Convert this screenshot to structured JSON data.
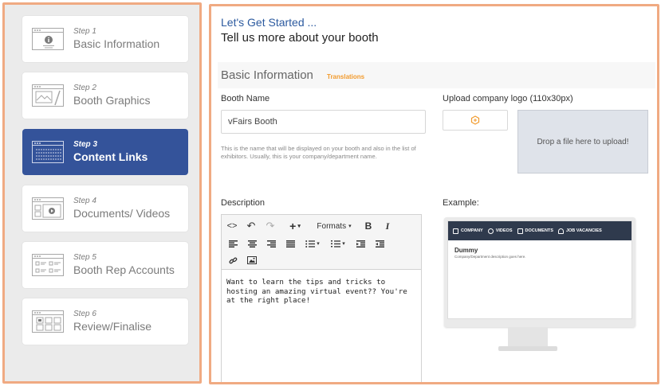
{
  "steps": [
    {
      "num": "Step 1",
      "label": "Basic Information",
      "icon": "info-window-icon"
    },
    {
      "num": "Step 2",
      "label": "Booth Graphics",
      "icon": "graphics-window-icon"
    },
    {
      "num": "Step 3",
      "label": "Content Links",
      "icon": "links-window-icon"
    },
    {
      "num": "Step 4",
      "label": "Documents/ Videos",
      "icon": "video-window-icon"
    },
    {
      "num": "Step 5",
      "label": "Booth Rep Accounts",
      "icon": "accounts-window-icon"
    },
    {
      "num": "Step 6",
      "label": "Review/Finalise",
      "icon": "review-window-icon"
    }
  ],
  "active_step": 2,
  "header": {
    "title": "Let's Get Started ...",
    "subtitle": "Tell us more about your booth"
  },
  "section": {
    "title": "Basic Information",
    "translations_link": "Translations"
  },
  "booth_name": {
    "label": "Booth Name",
    "value": "vFairs Booth",
    "help": "This is the name that will be displayed on your booth and also in the list of exhibitors. Usually, this is your company/department name."
  },
  "upload": {
    "label": "Upload company logo (110x30px)",
    "button_icon": "hexagon-upload-icon",
    "dropzone": "Drop a file here to upload!"
  },
  "description": {
    "label": "Description",
    "formats_label": "Formats",
    "text": "Want to learn the tips and tricks to hosting an amazing virtual event?? You're at the right place!"
  },
  "example": {
    "label": "Example:",
    "nav": [
      "COMPANY",
      "VIDEOS",
      "DOCUMENTS",
      "JOB VACANCIES"
    ],
    "title": "Dummy",
    "desc": "Company/Department description goes here."
  },
  "colors": {
    "accent": "#34539a",
    "border": "#f0aa82",
    "heading": "#2c5a9f",
    "translations": "#f29b2e"
  }
}
